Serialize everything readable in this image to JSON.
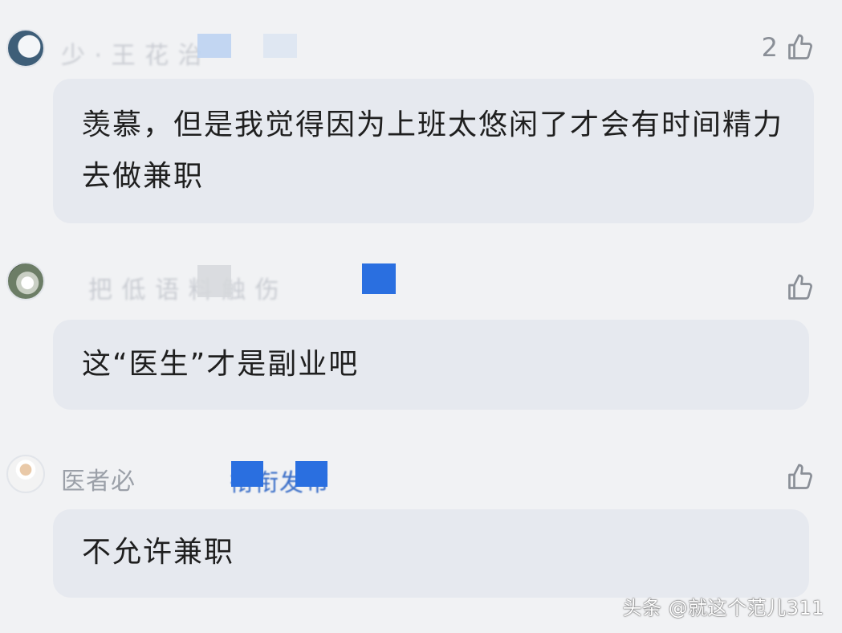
{
  "comments": [
    {
      "username": "少 · 王 花 治",
      "likes": "2",
      "text": "羡慕，但是我觉得因为上班太悠闲了才会有时间精力去做兼职"
    },
    {
      "username": "把 低 语 料 触 伤",
      "likes": "",
      "text": "这“医生”才是副业吧"
    },
    {
      "username": "医者必",
      "username_tail": "衔衔发布",
      "likes": "",
      "text": "不允许兼职"
    }
  ],
  "watermark": "头条 @就这个范儿311",
  "colors": {
    "background": "#f1f2f4",
    "bubble": "#e6e9ef",
    "censor_blue": "#2a6fe0",
    "censor_lightblue": "#bcd3f2"
  },
  "icons": {
    "like": "thumbs-up-outline",
    "avatar1": "gray-teal-circle",
    "avatar2": "white-bird-photo",
    "avatar3": "doctor-portrait"
  }
}
